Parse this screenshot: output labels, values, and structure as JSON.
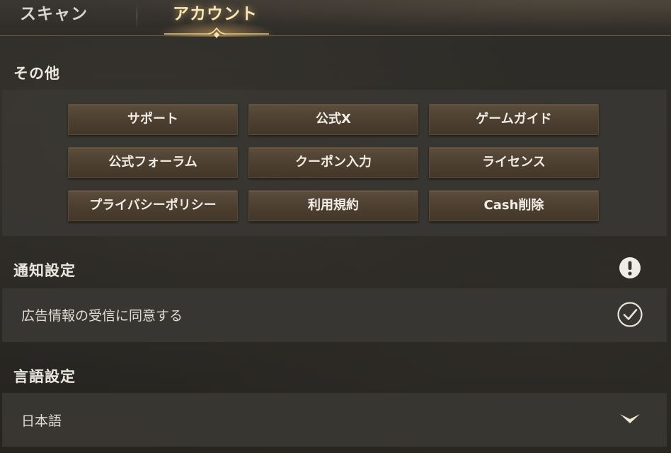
{
  "tabs": {
    "scan": "スキャン",
    "account": "アカウント"
  },
  "other": {
    "title": "その他",
    "buttons": [
      "サポート",
      "公式X",
      "ゲームガイド",
      "公式フォーラム",
      "クーポン入力",
      "ライセンス",
      "プライバシーポリシー",
      "利用規約",
      "Cash削除"
    ]
  },
  "notification": {
    "title": "通知設定",
    "ad_consent_label": "広告情報の受信に同意する",
    "ad_consent_checked": true
  },
  "language": {
    "title": "言語設定",
    "selected": "日本語"
  },
  "icons": {
    "alert": "exclamation-circle-icon",
    "check": "check-circle-icon",
    "dropdown": "chevron-down-icon"
  },
  "colors": {
    "accent_gold": "#f7e7b8",
    "button_brown": "#4c3f30"
  }
}
